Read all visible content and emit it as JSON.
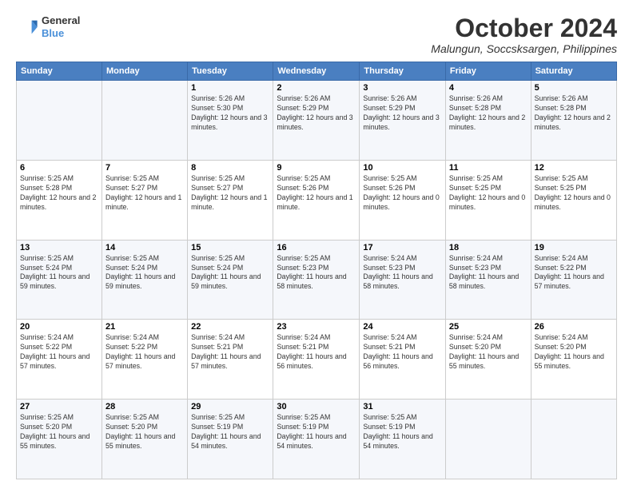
{
  "header": {
    "logo_line1": "General",
    "logo_line2": "Blue",
    "month": "October 2024",
    "location": "Malungun, Soccsksargen, Philippines"
  },
  "weekdays": [
    "Sunday",
    "Monday",
    "Tuesday",
    "Wednesday",
    "Thursday",
    "Friday",
    "Saturday"
  ],
  "weeks": [
    [
      {
        "day": "",
        "info": ""
      },
      {
        "day": "",
        "info": ""
      },
      {
        "day": "1",
        "info": "Sunrise: 5:26 AM\nSunset: 5:30 PM\nDaylight: 12 hours and 3 minutes."
      },
      {
        "day": "2",
        "info": "Sunrise: 5:26 AM\nSunset: 5:29 PM\nDaylight: 12 hours and 3 minutes."
      },
      {
        "day": "3",
        "info": "Sunrise: 5:26 AM\nSunset: 5:29 PM\nDaylight: 12 hours and 3 minutes."
      },
      {
        "day": "4",
        "info": "Sunrise: 5:26 AM\nSunset: 5:28 PM\nDaylight: 12 hours and 2 minutes."
      },
      {
        "day": "5",
        "info": "Sunrise: 5:26 AM\nSunset: 5:28 PM\nDaylight: 12 hours and 2 minutes."
      }
    ],
    [
      {
        "day": "6",
        "info": "Sunrise: 5:25 AM\nSunset: 5:28 PM\nDaylight: 12 hours and 2 minutes."
      },
      {
        "day": "7",
        "info": "Sunrise: 5:25 AM\nSunset: 5:27 PM\nDaylight: 12 hours and 1 minute."
      },
      {
        "day": "8",
        "info": "Sunrise: 5:25 AM\nSunset: 5:27 PM\nDaylight: 12 hours and 1 minute."
      },
      {
        "day": "9",
        "info": "Sunrise: 5:25 AM\nSunset: 5:26 PM\nDaylight: 12 hours and 1 minute."
      },
      {
        "day": "10",
        "info": "Sunrise: 5:25 AM\nSunset: 5:26 PM\nDaylight: 12 hours and 0 minutes."
      },
      {
        "day": "11",
        "info": "Sunrise: 5:25 AM\nSunset: 5:25 PM\nDaylight: 12 hours and 0 minutes."
      },
      {
        "day": "12",
        "info": "Sunrise: 5:25 AM\nSunset: 5:25 PM\nDaylight: 12 hours and 0 minutes."
      }
    ],
    [
      {
        "day": "13",
        "info": "Sunrise: 5:25 AM\nSunset: 5:24 PM\nDaylight: 11 hours and 59 minutes."
      },
      {
        "day": "14",
        "info": "Sunrise: 5:25 AM\nSunset: 5:24 PM\nDaylight: 11 hours and 59 minutes."
      },
      {
        "day": "15",
        "info": "Sunrise: 5:25 AM\nSunset: 5:24 PM\nDaylight: 11 hours and 59 minutes."
      },
      {
        "day": "16",
        "info": "Sunrise: 5:25 AM\nSunset: 5:23 PM\nDaylight: 11 hours and 58 minutes."
      },
      {
        "day": "17",
        "info": "Sunrise: 5:24 AM\nSunset: 5:23 PM\nDaylight: 11 hours and 58 minutes."
      },
      {
        "day": "18",
        "info": "Sunrise: 5:24 AM\nSunset: 5:23 PM\nDaylight: 11 hours and 58 minutes."
      },
      {
        "day": "19",
        "info": "Sunrise: 5:24 AM\nSunset: 5:22 PM\nDaylight: 11 hours and 57 minutes."
      }
    ],
    [
      {
        "day": "20",
        "info": "Sunrise: 5:24 AM\nSunset: 5:22 PM\nDaylight: 11 hours and 57 minutes."
      },
      {
        "day": "21",
        "info": "Sunrise: 5:24 AM\nSunset: 5:22 PM\nDaylight: 11 hours and 57 minutes."
      },
      {
        "day": "22",
        "info": "Sunrise: 5:24 AM\nSunset: 5:21 PM\nDaylight: 11 hours and 57 minutes."
      },
      {
        "day": "23",
        "info": "Sunrise: 5:24 AM\nSunset: 5:21 PM\nDaylight: 11 hours and 56 minutes."
      },
      {
        "day": "24",
        "info": "Sunrise: 5:24 AM\nSunset: 5:21 PM\nDaylight: 11 hours and 56 minutes."
      },
      {
        "day": "25",
        "info": "Sunrise: 5:24 AM\nSunset: 5:20 PM\nDaylight: 11 hours and 55 minutes."
      },
      {
        "day": "26",
        "info": "Sunrise: 5:24 AM\nSunset: 5:20 PM\nDaylight: 11 hours and 55 minutes."
      }
    ],
    [
      {
        "day": "27",
        "info": "Sunrise: 5:25 AM\nSunset: 5:20 PM\nDaylight: 11 hours and 55 minutes."
      },
      {
        "day": "28",
        "info": "Sunrise: 5:25 AM\nSunset: 5:20 PM\nDaylight: 11 hours and 55 minutes."
      },
      {
        "day": "29",
        "info": "Sunrise: 5:25 AM\nSunset: 5:19 PM\nDaylight: 11 hours and 54 minutes."
      },
      {
        "day": "30",
        "info": "Sunrise: 5:25 AM\nSunset: 5:19 PM\nDaylight: 11 hours and 54 minutes."
      },
      {
        "day": "31",
        "info": "Sunrise: 5:25 AM\nSunset: 5:19 PM\nDaylight: 11 hours and 54 minutes."
      },
      {
        "day": "",
        "info": ""
      },
      {
        "day": "",
        "info": ""
      }
    ]
  ]
}
